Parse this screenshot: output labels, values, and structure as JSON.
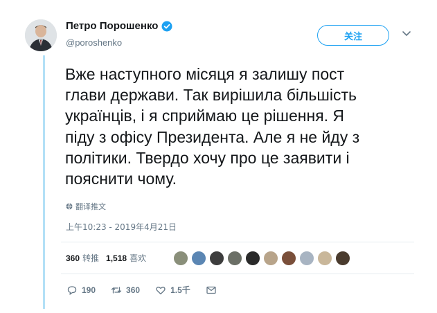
{
  "tweet": {
    "author_name": "Петро Порошенко",
    "author_handle": "@poroshenko",
    "follow_label": "关注",
    "text": "Вже наступного місяця я залишу пост\nглави держави. Так вирішила більшість\nукраїнців, і я сприймаю це рішення. Я\nпіду з офісу Президента. Але я не йду з\nполітики. Твердо хочу про це заявити і\nпояснити чому.",
    "translate_label": "翻译推文",
    "timestamp": "上午10:23 - 2019年4月21日"
  },
  "stats": {
    "retweets_count": "360",
    "retweets_label": "转推",
    "likes_count": "1,518",
    "likes_label": "喜欢"
  },
  "liker_avatars": [
    "#8a8f7a",
    "#5b86b3",
    "#3d3d3d",
    "#6b6f66",
    "#2a2a2a",
    "#b8a48a",
    "#7a4f3a",
    "#a8b4c2",
    "#c9b79a",
    "#4a3b2e"
  ],
  "actions": {
    "reply_count": "190",
    "retweet_count": "360",
    "like_count": "1.5千"
  },
  "colors": {
    "accent": "#1da1f2",
    "verified": "#1da1f2",
    "thread_line": "#b3e0f7"
  },
  "icons": [
    "verified-badge-icon",
    "chevron-down-icon",
    "globe-icon",
    "reply-icon",
    "retweet-icon",
    "heart-icon",
    "mail-icon"
  ]
}
